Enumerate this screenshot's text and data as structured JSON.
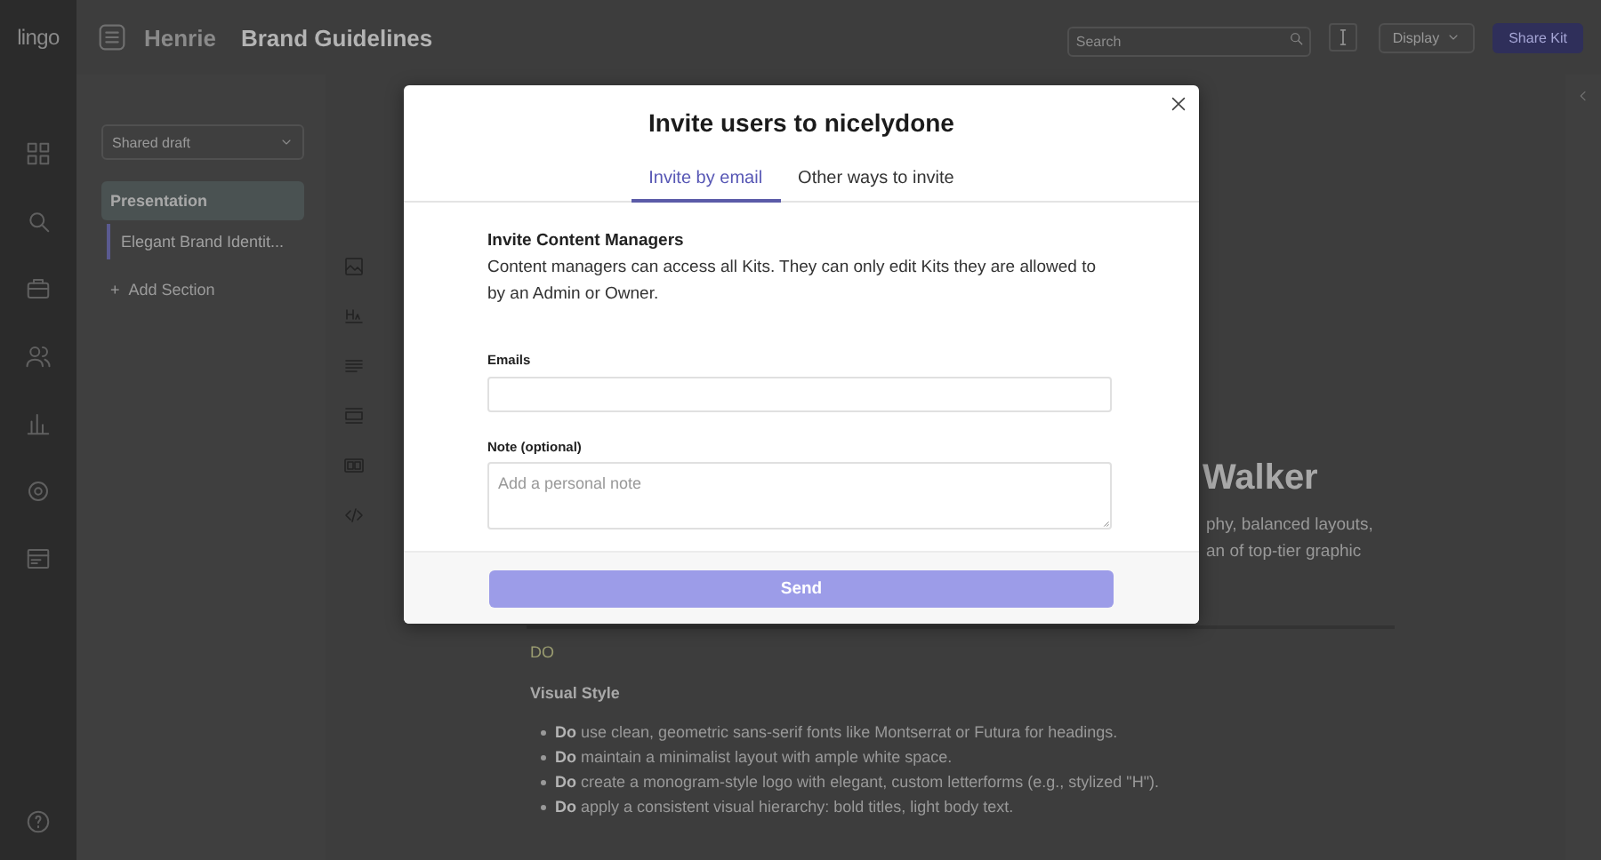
{
  "app": {
    "logo": "lingo"
  },
  "rail_icons": [
    {
      "kind": "grid"
    },
    {
      "kind": "search"
    },
    {
      "kind": "box"
    },
    {
      "kind": "users"
    },
    {
      "kind": "chart"
    },
    {
      "kind": "gear"
    },
    {
      "kind": "card"
    }
  ],
  "header": {
    "workspace": "Henrie",
    "title": "Brand Guidelines",
    "search": {
      "placeholder": "Search"
    },
    "display_button": "Display",
    "share_button": "Share Kit"
  },
  "sidebar": {
    "version_select": "Shared draft",
    "items": [
      {
        "kind": "section",
        "label": "Presentation",
        "selected": true
      },
      {
        "kind": "page",
        "label": "Elegant Brand Identit...",
        "selected": false
      },
      {
        "kind": "add",
        "icon": "+",
        "label": "Add Section",
        "selected": false
      }
    ]
  },
  "tool_icons": [
    {
      "kind": "image"
    },
    {
      "kind": "heading"
    },
    {
      "kind": "text"
    },
    {
      "kind": "banner"
    },
    {
      "kind": "media"
    },
    {
      "kind": "code"
    }
  ],
  "document": {
    "heading_fragment": "Walker",
    "paragraph_fragments": [
      "phy, balanced layouts,",
      "an of top-tier graphic"
    ],
    "do_label": "DO",
    "subheading": "Visual Style",
    "bullets": [
      "**Do** use clean, geometric sans-serif fonts like Montserrat or Futura for headings.",
      "**Do** maintain a minimalist layout with ample white space.",
      "**Do** create a monogram-style logo with elegant, custom letterforms (e.g., stylized \"H\").",
      "**Do** apply a consistent visual hierarchy: bold titles, light body text."
    ]
  },
  "modal": {
    "title": "Invite users to nicelydone",
    "tabs": [
      {
        "label": "Invite by email",
        "selected": true
      },
      {
        "label": "Other ways to invite",
        "selected": false
      }
    ],
    "section_title": "Invite Content Managers",
    "description": "Content managers can access all Kits. They can only edit Kits they are allowed to by an Admin or Owner.",
    "emails_label": "Emails",
    "note_label": "Note (optional)",
    "note_placeholder": "Add a personal note",
    "send_button": "Send",
    "send_disabled": true
  }
}
